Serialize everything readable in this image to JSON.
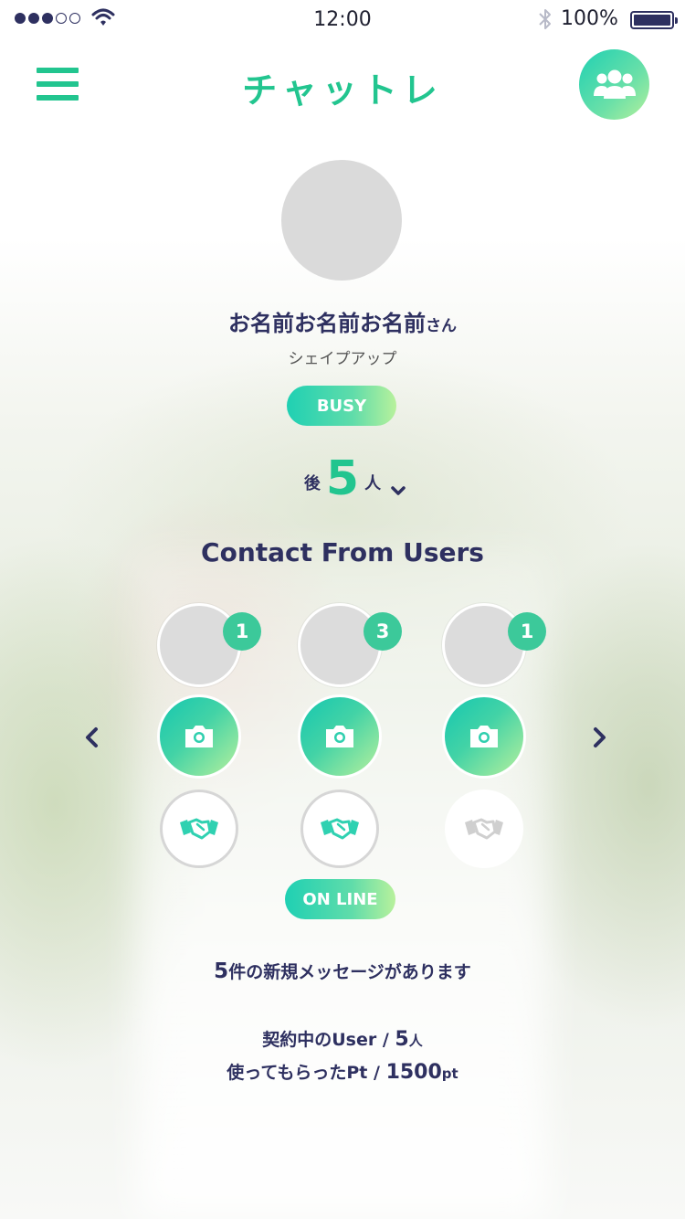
{
  "status_bar": {
    "time": "12:00",
    "battery": "100%"
  },
  "header": {
    "title": "チャットレ"
  },
  "profile": {
    "name": "お名前お名前お名前",
    "honorific": "さん",
    "category": "シェイプアップ",
    "status": "BUSY",
    "remaining_prefix": "後",
    "remaining_count": "5",
    "remaining_suffix": "人"
  },
  "contacts": {
    "title": "Contact From Users",
    "users": [
      {
        "badge": "1"
      },
      {
        "badge": "3"
      },
      {
        "badge": "1"
      }
    ],
    "status": "ON LINE"
  },
  "summary": {
    "new_messages_count": "5",
    "new_messages_text": "件の新規メッセージがあります",
    "contract_label": "契約中のUser / ",
    "contract_count": "5",
    "contract_unit": "人",
    "points_label": "使ってもらったPt / ",
    "points_value": "1500",
    "points_unit": "pt"
  },
  "colors": {
    "accent": "#22c58f",
    "navy": "#2e3060",
    "gradient_start": "#1fd0b3",
    "gradient_end": "#b8f19c"
  },
  "icons": [
    "menu-icon",
    "group-icon",
    "camera-icon",
    "handshake-icon",
    "chevron-left-icon",
    "chevron-right-icon",
    "chevron-down-icon"
  ]
}
